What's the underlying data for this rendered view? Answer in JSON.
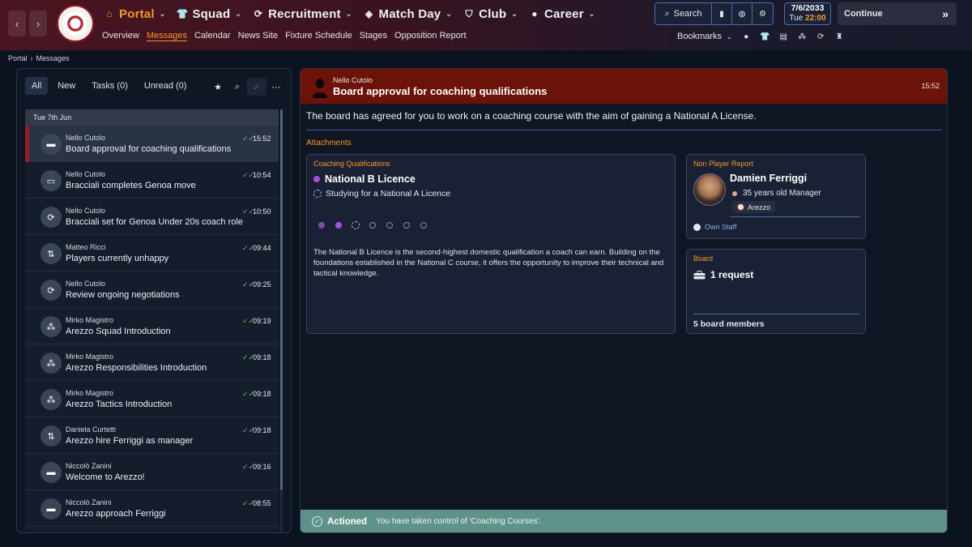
{
  "nav": {
    "back": "‹",
    "forward": "›",
    "items": [
      {
        "label": "Portal",
        "icon": "home-icon",
        "active": true
      },
      {
        "label": "Squad",
        "icon": "shirt-icon"
      },
      {
        "label": "Recruitment",
        "icon": "recruit-icon"
      },
      {
        "label": "Match Day",
        "icon": "matchday-icon"
      },
      {
        "label": "Club",
        "icon": "shield-icon"
      },
      {
        "label": "Career",
        "icon": "person-icon"
      }
    ],
    "sub_items": [
      "Overview",
      "Messages",
      "Calendar",
      "News Site",
      "Fixture Schedule",
      "Stages",
      "Opposition Report"
    ],
    "sub_active": "Messages"
  },
  "search": {
    "label": "Search"
  },
  "date": {
    "date": "7/6/2033",
    "day": "Tue",
    "time": "22:00"
  },
  "continue": {
    "label": "Continue"
  },
  "bookmarks": {
    "label": "Bookmarks"
  },
  "breadcrumb": {
    "root": "Portal",
    "current": "Messages"
  },
  "filters": {
    "all": "All",
    "new": "New",
    "tasks": "Tasks (0)",
    "unread": "Unread (0)"
  },
  "list": {
    "date_header": "Tue 7th Jun",
    "rows": [
      {
        "sender": "Nello Cutolo",
        "subject": "Board approval for coaching qualifications",
        "time": "15:52",
        "icon": "briefcase-icon",
        "read": true
      },
      {
        "sender": "Nello Cutolo",
        "subject": "Bracciali completes Genoa move",
        "time": "10:54",
        "icon": "id-card-icon",
        "read": false
      },
      {
        "sender": "Nello Cutolo",
        "subject": "Bracciali set for Genoa Under 20s coach role",
        "time": "10:50",
        "icon": "refresh-icon",
        "read": false
      },
      {
        "sender": "Matteo Ricci",
        "subject": "Players currently unhappy",
        "time": "09:44",
        "icon": "swap-icon",
        "read": false
      },
      {
        "sender": "Nello Cutolo",
        "subject": "Review ongoing negotiations",
        "time": "09:25",
        "icon": "refresh-icon",
        "read": false
      },
      {
        "sender": "Mirko Magistro",
        "subject": "Arezzo Squad Introduction",
        "time": "09:19",
        "icon": "group-icon",
        "read": true
      },
      {
        "sender": "Mirko Magistro",
        "subject": "Arezzo Responsibilities Introduction",
        "time": "09:18",
        "icon": "group-icon",
        "read": true
      },
      {
        "sender": "Mirko Magistro",
        "subject": "Arezzo Tactics Introduction",
        "time": "09:18",
        "icon": "group-icon",
        "read": true
      },
      {
        "sender": "Daniela Curtetti",
        "subject": "Arezzo hire Ferriggi as manager",
        "time": "09:18",
        "icon": "swap-icon",
        "read": false
      },
      {
        "sender": "Niccolò Zanini",
        "subject": "Welcome to Arezzo!",
        "time": "09:16",
        "icon": "briefcase-icon",
        "read": false
      },
      {
        "sender": "Niccolò Zanini",
        "subject": "Arezzo approach Ferriggi",
        "time": "08:55",
        "icon": "briefcase-icon",
        "read": true
      }
    ]
  },
  "message": {
    "from": "Nello Cutolo",
    "title": "Board approval for coaching qualifications",
    "time": "15:52",
    "body": "The board has agreed for you to work on a coaching course with the aim of gaining a National A License.",
    "attachments_label": "Attachments"
  },
  "qualification": {
    "title": "Coaching Qualifications",
    "licence": "National B Licence",
    "status": "Studying for a National A Licence",
    "steps_done": 2,
    "steps_total": 7,
    "description": "The National B Licence is the second-highest domestic qualification a coach can earn. Building on the foundations established in the National C course, it offers the opportunity to improve their technical and tactical knowledge."
  },
  "npr": {
    "title": "Non Player Report",
    "name": "Damien Ferriggi",
    "role": "35 years old Manager",
    "club": "Arezzo",
    "own_staff": "Own Staff"
  },
  "board": {
    "title": "Board",
    "requests": "1 request",
    "members": "5 board members"
  },
  "actioned": {
    "label": "Actioned",
    "text": "You have taken control of 'Coaching Courses'."
  },
  "colors": {
    "accent": "#f19a26",
    "header_red": "#6b1209",
    "actioned": "#5f938a",
    "purple": "#a34fe0"
  }
}
